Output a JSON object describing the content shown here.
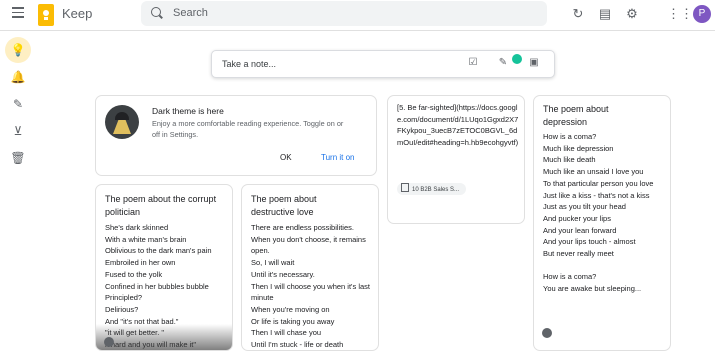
{
  "header": {
    "app_name": "Keep",
    "search_placeholder": "Search",
    "avatar_initial": "P"
  },
  "take_note": {
    "placeholder": "Take a note..."
  },
  "dark_theme_card": {
    "title": "Dark theme is here",
    "text": "Enjoy a more comfortable reading experience. Toggle on or off in Settings.",
    "ok_label": "OK",
    "turn_on_label": "Turn it on"
  },
  "notes": [
    {
      "title": "The poem about the corrupt politician",
      "body": "She's dark skinned\nWith a white man's brain\nOblivious to the dark man's pain\nEmbroiled in her own\nFused to the yolk\nConfined in her bubbles bubble\nPrincipled?\nDelirious?\nAnd \"it's not that bad.\"\n\"it will get better. \"\nk hard and you will make it\""
    },
    {
      "title": "The poem about destructive love",
      "body": "There are endless possibilities.\nWhen you don't choose, it remains open.\nSo, I will wait\nUntil it's necessary.\nThen I will choose you when it's last minute\nWhen you're moving on\nOr life is taking you away\nThen I will chase you\nUntil I'm stuck - life or death"
    },
    {
      "title": "",
      "body": "[5. Be far-sighted](https://docs.google.com/document/d/1LUqo1Ggxd2X7FKykpou_3uecB7zETOC0BGVL_6dmOuI/edit#heading=h.hb9ecohgyvtf)",
      "chip": "10 B2B Sales S..."
    },
    {
      "title": "The poem about depression",
      "body": "How is a coma?\nMuch like depression\nMuch like death\nMuch like an unsaid I love you\nTo that particular person you love\nJust like a kiss - that's not a kiss\nJust as you tilt your head\nAnd pucker your lips\nAnd your lean forward\nAnd your lips touch - almost\nBut never really meet\n\nHow is a coma?\nYou are awake but sleeping..."
    }
  ]
}
